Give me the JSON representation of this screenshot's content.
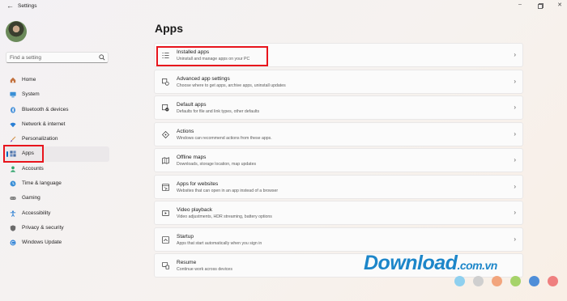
{
  "window": {
    "title": "Settings",
    "back_icon": "back-arrow-icon",
    "controls": [
      "minimize-icon",
      "maximize-icon",
      "close-icon"
    ]
  },
  "search": {
    "placeholder": "Find a setting",
    "icon": "search-icon"
  },
  "sidebar": {
    "items": [
      {
        "label": "Home",
        "icon": "home-icon",
        "color": "#c2703d"
      },
      {
        "label": "System",
        "icon": "system-icon",
        "color": "#3a8fd6"
      },
      {
        "label": "Bluetooth & devices",
        "icon": "bluetooth-icon",
        "color": "#2a7fd4"
      },
      {
        "label": "Network & internet",
        "icon": "wifi-icon",
        "color": "#2a7fd4"
      },
      {
        "label": "Personalization",
        "icon": "brush-icon",
        "color": "#d08a3a"
      },
      {
        "label": "Apps",
        "icon": "apps-icon",
        "color": "#4a6fa5",
        "active": true
      },
      {
        "label": "Accounts",
        "icon": "accounts-icon",
        "color": "#2fa36b"
      },
      {
        "label": "Time & language",
        "icon": "time-language-icon",
        "color": "#3a8fd6"
      },
      {
        "label": "Gaming",
        "icon": "gaming-icon",
        "color": "#7a7a7a"
      },
      {
        "label": "Accessibility",
        "icon": "accessibility-icon",
        "color": "#2a7fd4"
      },
      {
        "label": "Privacy & security",
        "icon": "shield-icon",
        "color": "#6a6a6a"
      },
      {
        "label": "Windows Update",
        "icon": "windows-update-icon",
        "color": "#2a7fd4"
      }
    ]
  },
  "main": {
    "title": "Apps",
    "cards": [
      {
        "title": "Installed apps",
        "subtitle": "Uninstall and manage apps on your PC",
        "icon": "installed-apps-icon"
      },
      {
        "title": "Advanced app settings",
        "subtitle": "Choose where to get apps, archive apps, uninstall updates",
        "icon": "advanced-app-settings-icon"
      },
      {
        "title": "Default apps",
        "subtitle": "Defaults for file and link types, other defaults",
        "icon": "default-apps-icon"
      },
      {
        "title": "Actions",
        "subtitle": "Windows can recommend actions from these apps.",
        "icon": "actions-icon"
      },
      {
        "title": "Offline maps",
        "subtitle": "Downloads, storage location, map updates",
        "icon": "offline-maps-icon"
      },
      {
        "title": "Apps for websites",
        "subtitle": "Websites that can open in an app instead of a browser",
        "icon": "apps-for-websites-icon"
      },
      {
        "title": "Video playback",
        "subtitle": "Video adjustments, HDR streaming, battery options",
        "icon": "video-playback-icon"
      },
      {
        "title": "Startup",
        "subtitle": "Apps that start automatically when you sign in",
        "icon": "startup-icon"
      },
      {
        "title": "Resume",
        "subtitle": "Continue work across devices",
        "icon": "resume-icon"
      }
    ]
  },
  "watermark": {
    "text": "Download",
    "suffix": ".com.vn",
    "dot_colors": [
      "#8fd0ef",
      "#cfcfcf",
      "#f2a57d",
      "#a6d36a",
      "#4f8ed8",
      "#ef7f7f"
    ]
  },
  "colors": {
    "accent": "#0067c0",
    "highlight": "#e8141c"
  }
}
